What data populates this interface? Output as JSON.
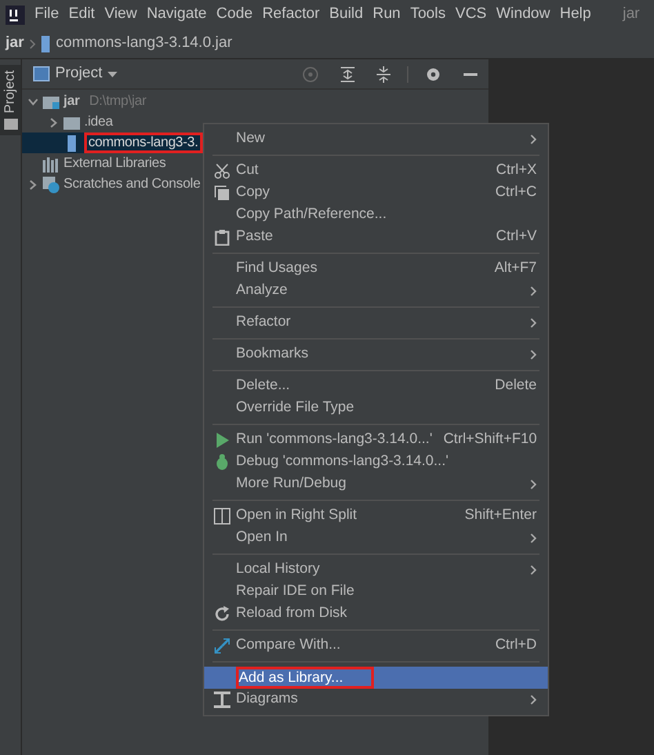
{
  "menu_bar": {
    "items": [
      "File",
      "Edit",
      "View",
      "Navigate",
      "Code",
      "Refactor",
      "Build",
      "Run",
      "Tools",
      "VCS",
      "Window",
      "Help"
    ],
    "project_title": "jar"
  },
  "breadcrumb": [
    "jar",
    "commons-lang3-3.14.0.jar"
  ],
  "tool_strip": {
    "label": "Project"
  },
  "project_panel": {
    "title": "Project",
    "tree": [
      {
        "label": "jar",
        "path": "D:\\tmp\\jar",
        "expanded": true,
        "selected": false,
        "highlighted": false,
        "children": [
          {
            "label": ".idea",
            "expanded": false,
            "selected": false,
            "highlighted": false
          },
          {
            "label": "commons-lang3-3.",
            "selected": true,
            "highlighted": true
          }
        ]
      },
      {
        "label": "External Libraries",
        "selected": false,
        "highlighted": false
      },
      {
        "label": "Scratches and Console",
        "expanded": false,
        "selected": false,
        "highlighted": false
      }
    ]
  },
  "context_menu": [
    {
      "kind": "item",
      "label": "New",
      "submenu": true,
      "selected": false,
      "highlighted": false
    },
    {
      "kind": "separator"
    },
    {
      "kind": "item",
      "label": "Cut",
      "shortcut": "Ctrl+X",
      "selected": false,
      "highlighted": false
    },
    {
      "kind": "item",
      "label": "Copy",
      "shortcut": "Ctrl+C",
      "selected": false,
      "highlighted": false
    },
    {
      "kind": "item",
      "label": "Copy Path/Reference...",
      "selected": false,
      "highlighted": false
    },
    {
      "kind": "item",
      "label": "Paste",
      "shortcut": "Ctrl+V",
      "selected": false,
      "highlighted": false
    },
    {
      "kind": "separator"
    },
    {
      "kind": "item",
      "label": "Find Usages",
      "shortcut": "Alt+F7",
      "selected": false,
      "highlighted": false
    },
    {
      "kind": "item",
      "label": "Analyze",
      "submenu": true,
      "selected": false,
      "highlighted": false
    },
    {
      "kind": "separator"
    },
    {
      "kind": "item",
      "label": "Refactor",
      "submenu": true,
      "selected": false,
      "highlighted": false
    },
    {
      "kind": "separator"
    },
    {
      "kind": "item",
      "label": "Bookmarks",
      "submenu": true,
      "selected": false,
      "highlighted": false
    },
    {
      "kind": "separator"
    },
    {
      "kind": "item",
      "label": "Delete...",
      "shortcut": "Delete",
      "selected": false,
      "highlighted": false
    },
    {
      "kind": "item",
      "label": "Override File Type",
      "selected": false,
      "highlighted": false
    },
    {
      "kind": "separator"
    },
    {
      "kind": "item",
      "label": "Run 'commons-lang3-3.14.0...'",
      "shortcut": "Ctrl+Shift+F10",
      "selected": false,
      "highlighted": false
    },
    {
      "kind": "item",
      "label": "Debug 'commons-lang3-3.14.0...'",
      "selected": false,
      "highlighted": false
    },
    {
      "kind": "item",
      "label": "More Run/Debug",
      "submenu": true,
      "selected": false,
      "highlighted": false
    },
    {
      "kind": "separator"
    },
    {
      "kind": "item",
      "label": "Open in Right Split",
      "shortcut": "Shift+Enter",
      "selected": false,
      "highlighted": false
    },
    {
      "kind": "item",
      "label": "Open In",
      "submenu": true,
      "selected": false,
      "highlighted": false
    },
    {
      "kind": "separator"
    },
    {
      "kind": "item",
      "label": "Local History",
      "submenu": true,
      "selected": false,
      "highlighted": false
    },
    {
      "kind": "item",
      "label": "Repair IDE on File",
      "selected": false,
      "highlighted": false
    },
    {
      "kind": "item",
      "label": "Reload from Disk",
      "selected": false,
      "highlighted": false
    },
    {
      "kind": "separator"
    },
    {
      "kind": "item",
      "label": "Compare With...",
      "shortcut": "Ctrl+D",
      "selected": false,
      "highlighted": false
    },
    {
      "kind": "separator"
    },
    {
      "kind": "item",
      "label": "Add as Library...",
      "selected": true,
      "highlighted": true
    },
    {
      "kind": "item",
      "label": "Diagrams",
      "submenu": true,
      "selected": false,
      "highlighted": false
    }
  ]
}
